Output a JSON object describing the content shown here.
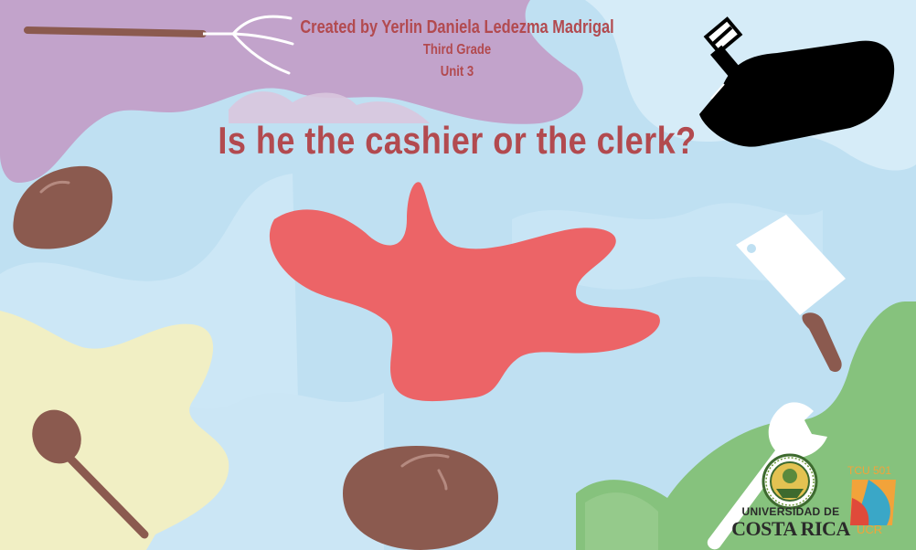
{
  "credits": {
    "author": "Created by Yerlin Daniela Ledezma Madrigal",
    "grade": "Third Grade",
    "unit": "Unit 3"
  },
  "question": "Is he the cashier or the clerk?",
  "logos": {
    "university_line1": "UNIVERSIDAD DE",
    "university_line2": "COSTA RICA",
    "tcu_label": "TCU 501",
    "tcu_sub": "UCR"
  },
  "colors": {
    "background": "#bfe0f2",
    "accent_text": "#b24a4f",
    "purple_blob": "#c2a3cb",
    "red_blob": "#ec6467",
    "yellow_blob": "#f1efc4",
    "green_blob": "#86c27d",
    "brown": "#8b5a4f"
  },
  "icons": [
    "pitchfork-icon",
    "bottle-icon",
    "bread-icon",
    "cleaver-icon",
    "spoon-icon",
    "wrench-icon"
  ]
}
